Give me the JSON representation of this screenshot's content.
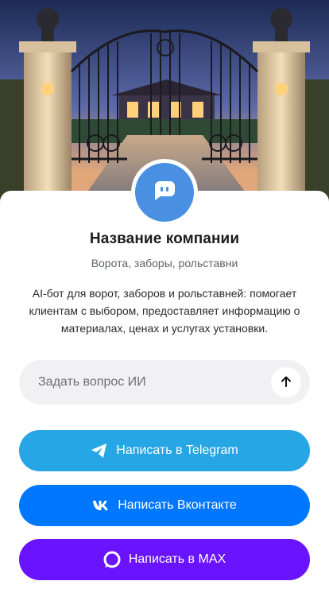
{
  "company": {
    "name": "Название компании",
    "subtitle": "Ворота, заборы, рольставни",
    "description": "AI-бот для ворот, заборов и рольставней: помогает клиентам с выбором, предоставляет информацию о материалах, ценах и услугах установки."
  },
  "ask": {
    "placeholder": "Задать вопрос ИИ",
    "value": ""
  },
  "buttons": {
    "telegram": {
      "label": "Написать в Telegram",
      "icon": "telegram-icon",
      "color": "#27a6e5"
    },
    "vk": {
      "label": "Написать Вконтакте",
      "icon": "vk-icon",
      "color": "#0077ff"
    },
    "max": {
      "label": "Написать в MAX",
      "icon": "max-icon",
      "color": "#6a13ff"
    }
  },
  "colors": {
    "avatar": "#4a90e2",
    "input_bg": "#f1f1f3"
  },
  "icons": {
    "avatar": "chat-bot-icon",
    "send": "arrow-up-icon"
  }
}
